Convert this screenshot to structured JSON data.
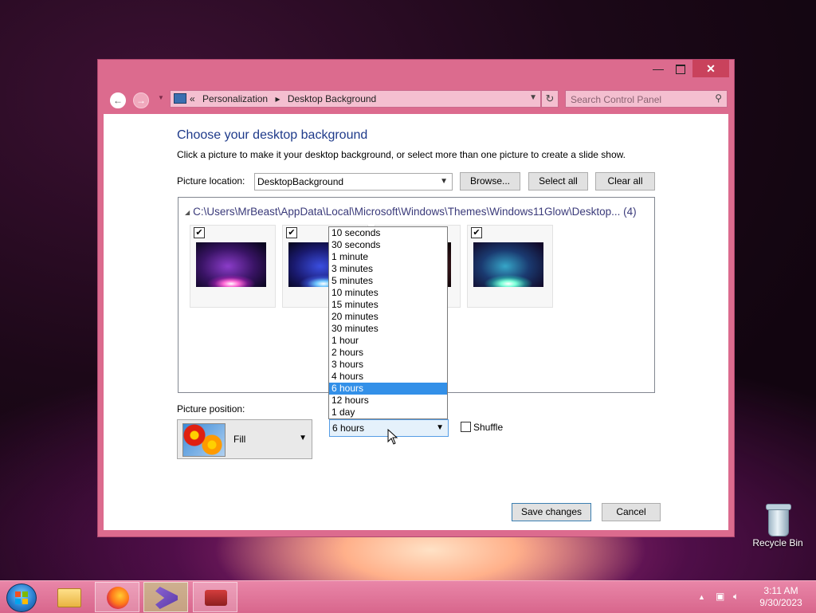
{
  "window": {
    "controls": {
      "minimize": "—",
      "close": "✕"
    },
    "nav": {
      "back_icon": "back-arrow-icon",
      "forward_icon": "forward-arrow-icon"
    },
    "address": {
      "prefix": "«",
      "crumbs": [
        "Personalization",
        "Desktop Background"
      ],
      "separator": "▸"
    },
    "search": {
      "placeholder": "Search Control Panel"
    }
  },
  "page": {
    "heading": "Choose your desktop background",
    "subtext": "Click a picture to make it your desktop background, or select more than one picture to create a slide show.",
    "location_label": "Picture location:",
    "location_value": "DesktopBackground",
    "browse_label": "Browse...",
    "select_all_label": "Select all",
    "clear_all_label": "Clear all",
    "folder_path": "C:\\Users\\MrBeast\\AppData\\Local\\Microsoft\\Windows\\Themes\\Windows11Glow\\Desktop... (4)",
    "thumbnails": [
      {
        "checked": true,
        "accent": "#b040e0"
      },
      {
        "checked": true,
        "accent": "#3a60e8"
      },
      {
        "checked": true,
        "accent": "#e06a40"
      },
      {
        "checked": true,
        "accent": "#30d0c0"
      }
    ],
    "position_label": "Picture position:",
    "position_value": "Fill",
    "interval_value": "6 hours",
    "interval_options": [
      "10 seconds",
      "30 seconds",
      "1 minute",
      "3 minutes",
      "5 minutes",
      "10 minutes",
      "15 minutes",
      "20 minutes",
      "30 minutes",
      "1 hour",
      "2 hours",
      "3 hours",
      "4 hours",
      "6 hours",
      "12 hours",
      "1 day"
    ],
    "interval_selected_index": 13,
    "shuffle_label": "Shuffle",
    "shuffle_checked": false,
    "save_label": "Save changes",
    "cancel_label": "Cancel"
  },
  "desktop": {
    "recycle_bin_label": "Recycle Bin"
  },
  "taskbar": {
    "items": [
      "file-explorer",
      "firefox",
      "visual-studio-installer",
      "toolbox"
    ],
    "clock_time": "3:11 AM",
    "clock_date": "9/30/2023"
  },
  "colors": {
    "window_frame": "#dc6b8e",
    "close_button": "#c9425c",
    "selection": "#3390e8",
    "heading": "#1e3a8a"
  }
}
